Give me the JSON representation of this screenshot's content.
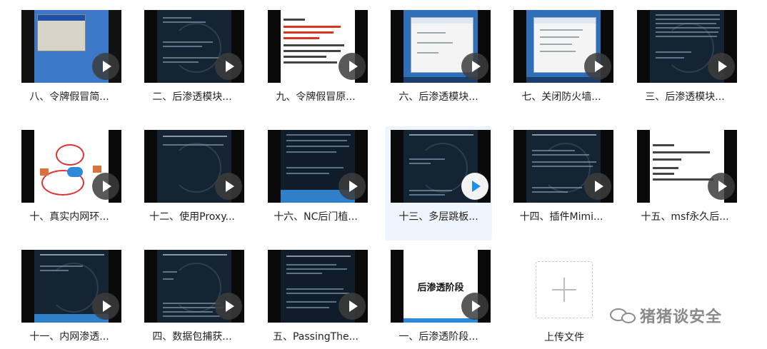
{
  "tiles": [
    {
      "label": "八、令牌假冒简..."
    },
    {
      "label": "二、后渗透模块..."
    },
    {
      "label": "九、令牌假冒原..."
    },
    {
      "label": "六、后渗透模块..."
    },
    {
      "label": "七、关闭防火墙..."
    },
    {
      "label": "三、后渗透模块..."
    },
    {
      "label": "十、真实内网环..."
    },
    {
      "label": "十二、使用Proxy..."
    },
    {
      "label": "十六、NC后门植..."
    },
    {
      "label": "十三、多层跳板..."
    },
    {
      "label": "十四、插件Mimi..."
    },
    {
      "label": "十五、msf永久后..."
    },
    {
      "label": "十一、内网渗透..."
    },
    {
      "label": "四、数据包捕获..."
    },
    {
      "label": "五、PassingThe..."
    },
    {
      "label": "一、后渗透阶段...",
      "thumb_title": "后渗透阶段"
    }
  ],
  "upload": {
    "label": "上传文件"
  },
  "watermark": {
    "text": "猪猪谈安全"
  },
  "colors": {
    "accent": "#1e8ef0",
    "selected_bg": "#eef5fd"
  }
}
